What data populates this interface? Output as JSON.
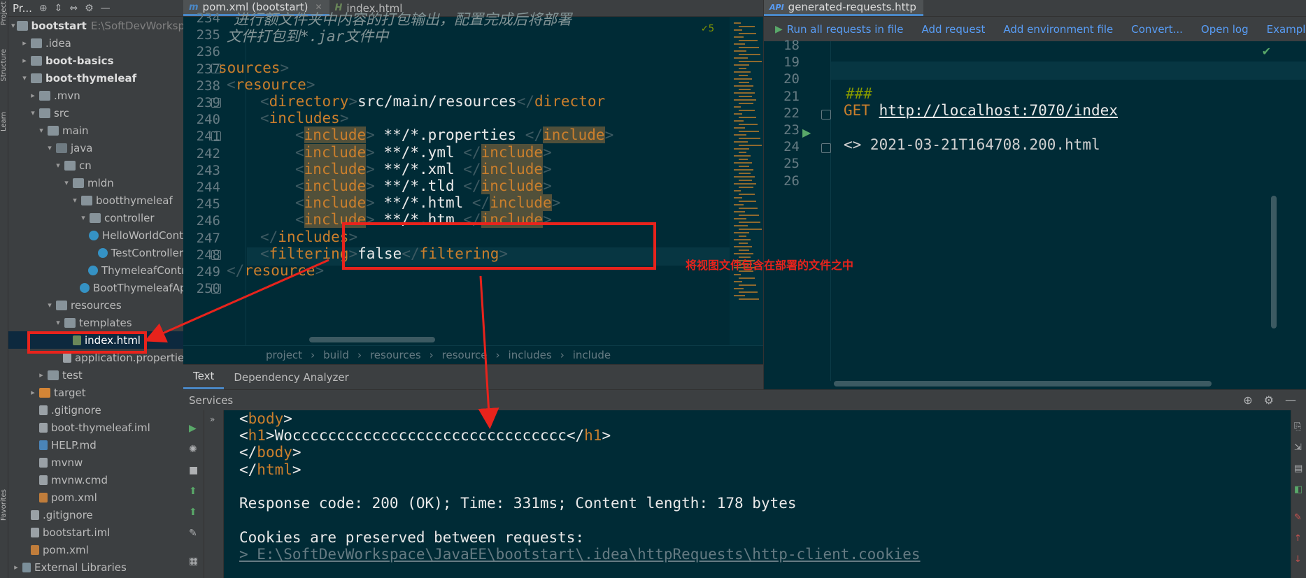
{
  "left_strip": {
    "labels": [
      "Project",
      "Structure",
      "Learn",
      "Favorites"
    ]
  },
  "project_panel": {
    "title": "Pr...",
    "tree": [
      {
        "label": "bootstart",
        "extra": "E:\\SoftDevWorkspa",
        "bold": true,
        "indent": 0,
        "arrow": "▾",
        "icon": "folder"
      },
      {
        "label": ".idea",
        "indent": 1,
        "arrow": "▸",
        "icon": "folder"
      },
      {
        "label": "boot-basics",
        "bold": true,
        "indent": 1,
        "arrow": "▸",
        "icon": "folder"
      },
      {
        "label": "boot-thymeleaf",
        "bold": true,
        "indent": 1,
        "arrow": "▾",
        "icon": "folder"
      },
      {
        "label": ".mvn",
        "indent": 2,
        "arrow": "▸",
        "icon": "folder"
      },
      {
        "label": "src",
        "indent": 2,
        "arrow": "▾",
        "icon": "folder"
      },
      {
        "label": "main",
        "indent": 3,
        "arrow": "▾",
        "icon": "folder"
      },
      {
        "label": "java",
        "indent": 4,
        "arrow": "▾",
        "icon": "folder-src"
      },
      {
        "label": "cn",
        "indent": 5,
        "arrow": "▾",
        "icon": "folder"
      },
      {
        "label": "mldn",
        "indent": 6,
        "arrow": "▾",
        "icon": "folder"
      },
      {
        "label": "bootthymeleaf",
        "indent": 7,
        "arrow": "▾",
        "icon": "folder"
      },
      {
        "label": "controller",
        "indent": 8,
        "arrow": "▾",
        "icon": "folder"
      },
      {
        "label": "HelloWorldCont",
        "indent": 9,
        "arrow": "",
        "icon": "java"
      },
      {
        "label": "TestController",
        "indent": 9,
        "arrow": "",
        "icon": "java"
      },
      {
        "label": "ThymeleafContr",
        "indent": 9,
        "arrow": "",
        "icon": "java"
      },
      {
        "label": "BootThymeleafAp",
        "indent": 8,
        "arrow": "",
        "icon": "java"
      },
      {
        "label": "resources",
        "indent": 4,
        "arrow": "▾",
        "icon": "folder"
      },
      {
        "label": "templates",
        "indent": 5,
        "arrow": "▾",
        "icon": "folder"
      },
      {
        "label": "index.html",
        "indent": 6,
        "arrow": "",
        "icon": "html",
        "selected": true
      },
      {
        "label": "application.properties",
        "indent": 6,
        "arrow": "",
        "icon": "file"
      },
      {
        "label": "test",
        "indent": 3,
        "arrow": "▸",
        "icon": "folder"
      },
      {
        "label": "target",
        "indent": 2,
        "arrow": "▸",
        "icon": "folder-orange"
      },
      {
        "label": ".gitignore",
        "indent": 2,
        "arrow": "",
        "icon": "file"
      },
      {
        "label": "boot-thymeleaf.iml",
        "indent": 2,
        "arrow": "",
        "icon": "file"
      },
      {
        "label": "HELP.md",
        "indent": 2,
        "arrow": "",
        "icon": "md"
      },
      {
        "label": "mvnw",
        "indent": 2,
        "arrow": "",
        "icon": "file"
      },
      {
        "label": "mvnw.cmd",
        "indent": 2,
        "arrow": "",
        "icon": "file"
      },
      {
        "label": "pom.xml",
        "indent": 2,
        "arrow": "",
        "icon": "xml"
      },
      {
        "label": ".gitignore",
        "indent": 1,
        "arrow": "",
        "icon": "file"
      },
      {
        "label": "bootstart.iml",
        "indent": 1,
        "arrow": "",
        "icon": "file"
      },
      {
        "label": "pom.xml",
        "indent": 1,
        "arrow": "",
        "icon": "xml"
      },
      {
        "label": "External Libraries",
        "indent": 0,
        "arrow": "▸",
        "icon": "lib"
      }
    ]
  },
  "editor1": {
    "tabs": [
      {
        "label": "pom.xml (bootstart)",
        "icon": "m",
        "active": true
      },
      {
        "label": "index.html",
        "icon": "H",
        "active": false
      }
    ],
    "inspection_count": "✓5",
    "line_numbers": [
      "234",
      "235",
      "236",
      "237",
      "238",
      "239",
      "240",
      "241",
      "242",
      "243",
      "244",
      "245",
      "246",
      "247",
      "248",
      "249",
      "250"
    ],
    "comment_line_1": "进行额文件夹中内容的打包输出，配置完成后将部署",
    "comment_line_2": "文件打包到*.jar文件中",
    "resources_tag": "sources",
    "resource_tag": "resource",
    "directory_tag": "directory",
    "directory_value": "src/main/resources",
    "directory_close": "director",
    "includes_tag": "includes",
    "include_tag": "include",
    "include_values": [
      "**/*.properties",
      "**/*.yml",
      "**/*.xml",
      "**/*.tld",
      "**/*.html",
      "**/*.htm"
    ],
    "filtering_tag": "filtering",
    "filtering_value": "false",
    "breadcrumb": [
      "project",
      "build",
      "resources",
      "resource",
      "includes",
      "include"
    ]
  },
  "editor2": {
    "tab_label": "generated-requests.http",
    "toolbar": [
      "Run all requests in file",
      "Add request",
      "Add environment file",
      "Convert...",
      "Open log",
      "Examples"
    ],
    "line_numbers": [
      "18",
      "19",
      "20",
      "21",
      "22",
      "23",
      "24",
      "25",
      "26"
    ],
    "separator": "###",
    "method": "GET",
    "url": "http://localhost:7070/index",
    "response_ref": "<> 2021-03-21T164708.200.html"
  },
  "bottom_tabs": [
    "Text",
    "Dependency Analyzer"
  ],
  "services": {
    "title": "Services",
    "output_lines": {
      "body_open_tag": "body",
      "h1_tag": "h1",
      "h1_text": "Woccccccccccccccccccccccccccccccc",
      "body_close_tag": "body",
      "html_close_tag": "html",
      "response": "Response code: 200 (OK); Time: 331ms; Content length: 178 bytes",
      "cookies": "Cookies are preserved between requests:",
      "path": "> E:\\SoftDevWorkspace\\JavaEE\\bootstart\\.idea\\httpRequests\\http-client.cookies"
    }
  },
  "annotation": {
    "text": "将视图文件包含在部署的文件之中",
    "color": "#e8231c"
  }
}
